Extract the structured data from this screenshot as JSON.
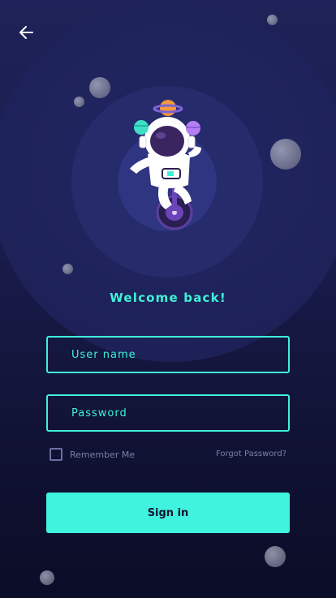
{
  "header": {
    "back_icon": "arrow-left-icon"
  },
  "illustration": {
    "icon": "astronaut-on-unicycle-icon"
  },
  "welcome": {
    "title": "Welcome back!"
  },
  "form": {
    "username_placeholder": "User name",
    "username_value": "",
    "password_placeholder": "Password",
    "password_value": "",
    "remember_label": "Remember Me",
    "remember_checked": false,
    "forgot_label": "Forgot Password?",
    "signin_label": "Sign in"
  },
  "colors": {
    "accent": "#3ef2d6",
    "background_top": "#1e2258",
    "background_bottom": "#0b0c26",
    "muted_text": "#7b7fa6"
  }
}
